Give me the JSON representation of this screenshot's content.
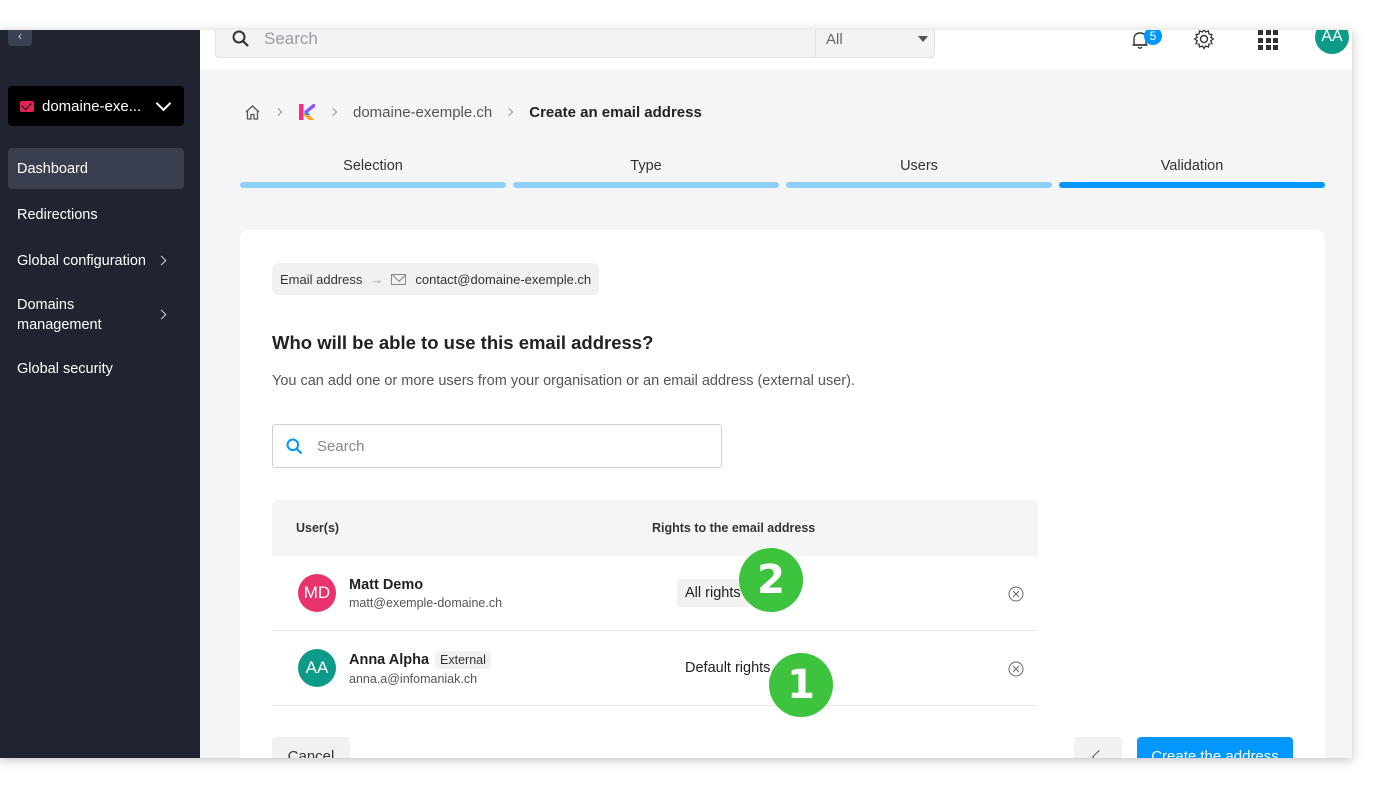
{
  "sidebar": {
    "collapse_glyph": "‹",
    "domain_selector": "domaine-exe...",
    "items": [
      {
        "label": "Dashboard",
        "active": true
      },
      {
        "label": "Redirections"
      },
      {
        "label": "Global configuration"
      },
      {
        "label": "Domains management"
      },
      {
        "label": "Global security"
      }
    ]
  },
  "topbar": {
    "search_placeholder": "Search",
    "filter_value": "All",
    "notifications_count": "5",
    "user_initials": "AA"
  },
  "breadcrumb": {
    "domain": "domaine-exemple.ch",
    "current": "Create an email address"
  },
  "steps": [
    {
      "label": "Selection"
    },
    {
      "label": "Type"
    },
    {
      "label": "Users"
    },
    {
      "label": "Validation"
    }
  ],
  "summary_chip": {
    "label": "Email address",
    "arrow": "→",
    "value": "contact@domaine-exemple.ch"
  },
  "question": "Who will be able to use this email address?",
  "description": "You can add one or more users from your organisation or an email address (external user).",
  "user_search_placeholder": "Search",
  "table": {
    "headers": [
      "User(s)",
      "Rights to the email address"
    ],
    "rows": [
      {
        "initials": "MD",
        "name": "Matt Demo",
        "tag": "",
        "email": "matt@exemple-domaine.ch",
        "rights": "All rights"
      },
      {
        "initials": "AA",
        "name": "Anna Alpha",
        "tag": "External",
        "email": "anna.a@infomaniak.ch",
        "rights": "Default rights"
      }
    ]
  },
  "buttons": {
    "cancel": "Cancel",
    "create": "Create the address"
  },
  "markers": [
    "1",
    "2"
  ],
  "colors": {
    "sidebar_bg": "#1f2430",
    "accent": "#0098ff",
    "step_done": "#8fd0fb",
    "avatar_md": "#e8336d",
    "avatar_aa": "#0c9b86",
    "marker": "#3ec33f",
    "brand_mail": "#e52455"
  }
}
